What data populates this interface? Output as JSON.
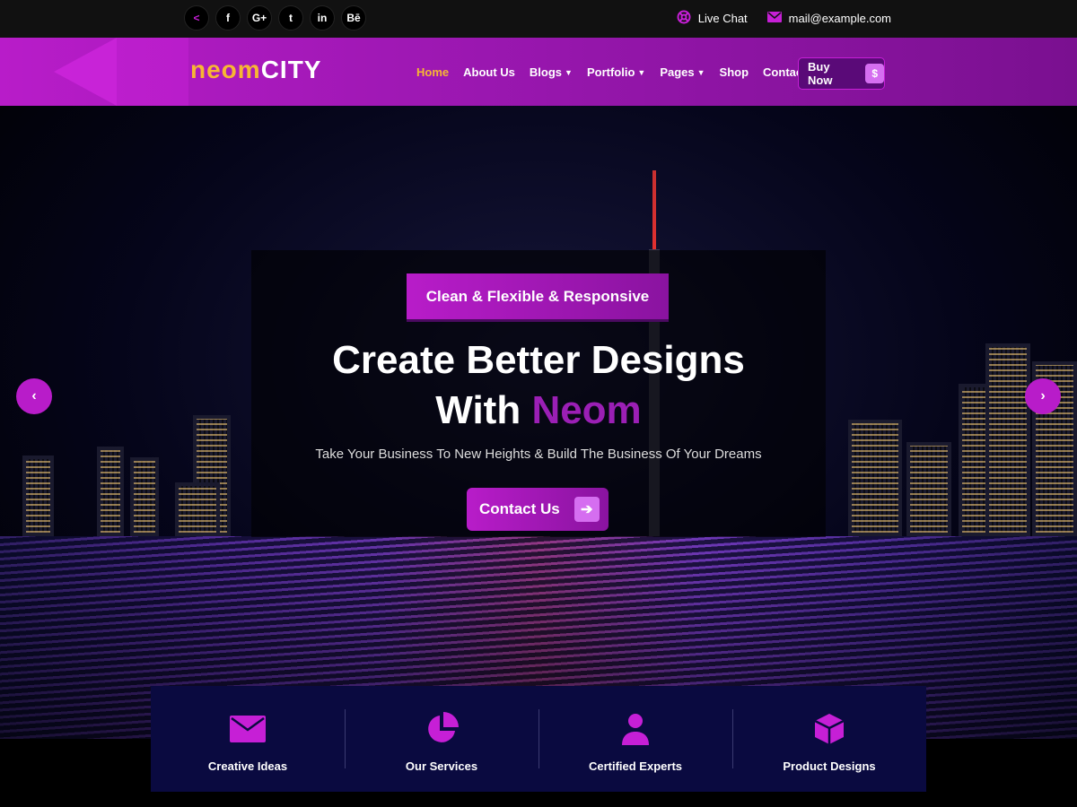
{
  "topbar": {
    "social": [
      {
        "icon": "share-icon",
        "glyph": "<"
      },
      {
        "icon": "facebook-icon",
        "glyph": "f"
      },
      {
        "icon": "google-plus-icon",
        "glyph": "G+"
      },
      {
        "icon": "twitter-icon",
        "glyph": "t"
      },
      {
        "icon": "linkedin-icon",
        "glyph": "in"
      },
      {
        "icon": "behance-icon",
        "glyph": "Bē"
      }
    ],
    "live_chat": "Live Chat",
    "email": "mail@example.com"
  },
  "logo": {
    "part1": "neom",
    "part2": "CITY"
  },
  "nav": {
    "items": [
      {
        "label": "Home",
        "active": true,
        "dropdown": false
      },
      {
        "label": "About Us",
        "dropdown": false
      },
      {
        "label": "Blogs",
        "dropdown": true
      },
      {
        "label": "Portfolio",
        "dropdown": true
      },
      {
        "label": "Pages",
        "dropdown": true
      },
      {
        "label": "Shop",
        "dropdown": false
      },
      {
        "label": "Contact Us",
        "dropdown": false
      }
    ],
    "buy_label": "Buy Now",
    "buy_icon": "$"
  },
  "hero": {
    "tagline": "Clean & Flexible & Responsive",
    "headline_line1": "Create Better Designs",
    "headline_with": "With",
    "headline_accent": "Neom",
    "subtitle": "Take Your Business To New Heights & Build The Business Of Your Dreams",
    "cta_label": "Contact Us"
  },
  "features": [
    {
      "icon": "envelope-icon",
      "label": "Creative Ideas"
    },
    {
      "icon": "pie-chart-icon",
      "label": "Our Services"
    },
    {
      "icon": "user-icon",
      "label": "Certified Experts"
    },
    {
      "icon": "box-icon",
      "label": "Product Designs"
    }
  ],
  "colors": {
    "accent": "#b81cc9",
    "highlight": "#f7b733",
    "feature_bg": "#0a0a40"
  }
}
